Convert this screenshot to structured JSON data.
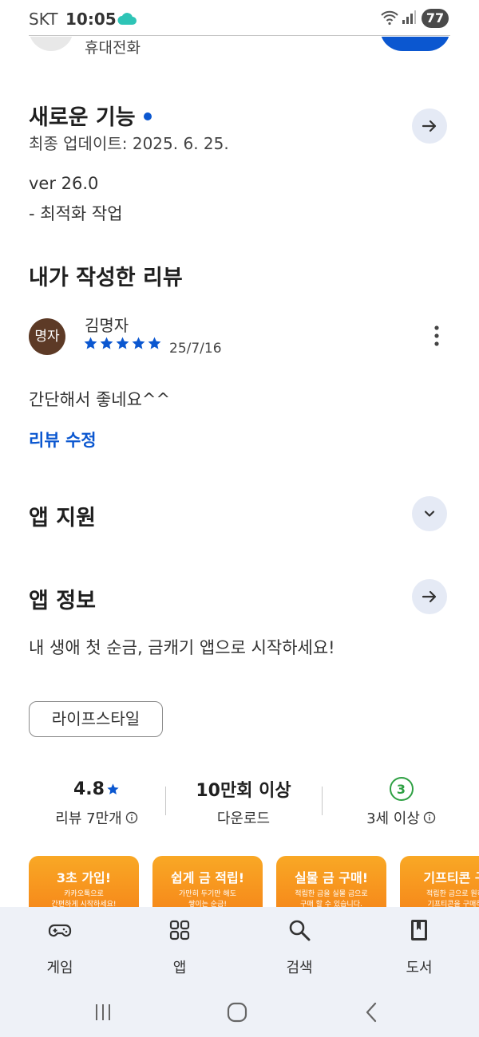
{
  "status_bar": {
    "carrier": "SKT",
    "time": "10:05",
    "battery": "77"
  },
  "top_header": {
    "subtitle": "휴대전화"
  },
  "whats_new": {
    "title": "새로운 기능",
    "last_updated": "최종 업데이트: 2025. 6. 25.",
    "version": "ver 26.0",
    "note": "- 최적화 작업"
  },
  "my_review": {
    "title": "내가 작성한 리뷰",
    "avatar_text": "명자",
    "reviewer_name": "김명자",
    "rating": 5,
    "date": "25/7/16",
    "text": "간단해서 좋네요^^",
    "edit_label": "리뷰 수정"
  },
  "app_support": {
    "title": "앱 지원"
  },
  "app_info": {
    "title": "앱 정보",
    "description": "내 생애 첫 순금, 금캐기 앱으로 시작하세요!",
    "category_chip": "라이프스타일"
  },
  "stats": {
    "rating_value": "4.8",
    "rating_label": "리뷰 7만개",
    "downloads_value": "10만회 이상",
    "downloads_label": "다운로드",
    "age_badge": "3",
    "age_label": "3세 이상"
  },
  "screenshots": [
    {
      "title": "3초 가입!",
      "line1": "카카오톡으로",
      "line2": "간편하게 시작하세요!"
    },
    {
      "title": "쉽게 금 적립!",
      "line1": "가만히 두기만 해도",
      "line2": "쌓이는 순금!"
    },
    {
      "title": "실물 금 구매!",
      "line1": "적립한 금을 실물 금으로",
      "line2": "구매 할 수 있습니다."
    },
    {
      "title": "기프티콘 구",
      "line1": "적립한 금으로 원하",
      "line2": "기프티콘을 구매하"
    }
  ],
  "bottom_nav": [
    {
      "label": "게임",
      "icon": "gamepad-icon"
    },
    {
      "label": "앱",
      "icon": "apps-grid-icon"
    },
    {
      "label": "검색",
      "icon": "search-icon"
    },
    {
      "label": "도서",
      "icon": "book-icon"
    }
  ],
  "colors": {
    "accent": "#0b57d0",
    "nav_bg": "#eef1f7",
    "age_green": "#2ea043",
    "avatar_brown": "#5d3a26"
  }
}
